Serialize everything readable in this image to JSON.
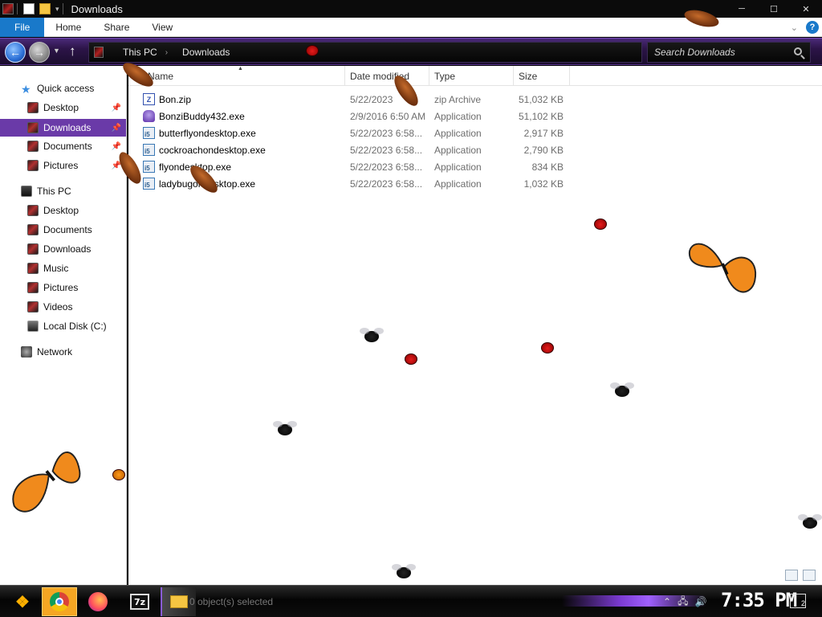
{
  "window": {
    "title": "Downloads",
    "controls": {
      "minimize": "─",
      "maximize": "☐",
      "close": "✕"
    }
  },
  "ribbon": {
    "tabs": [
      "File",
      "Home",
      "Share",
      "View"
    ],
    "help": "?"
  },
  "navigation": {
    "back": "←",
    "up": "↑",
    "breadcrumb": [
      "This PC",
      "Downloads"
    ],
    "search_placeholder": "Search Downloads"
  },
  "sidebar": {
    "quick_access": "Quick access",
    "quick_items": [
      {
        "label": "Desktop",
        "pinned": true
      },
      {
        "label": "Downloads",
        "pinned": true,
        "selected": true
      },
      {
        "label": "Documents",
        "pinned": true
      },
      {
        "label": "Pictures",
        "pinned": true
      }
    ],
    "this_pc": "This PC",
    "pc_items": [
      "Desktop",
      "Documents",
      "Downloads",
      "Music",
      "Pictures",
      "Videos",
      "Local Disk (C:)"
    ],
    "network": "Network"
  },
  "columns": {
    "name": "Name",
    "date": "Date modified",
    "type": "Type",
    "size": "Size"
  },
  "files": [
    {
      "name": "Bon.zip",
      "date": "5/22/2023",
      "type": "zip Archive",
      "size": "51,032 KB",
      "icon": "zip-icon"
    },
    {
      "name": "BonziBuddy432.exe",
      "date": "2/9/2016 6:50 AM",
      "type": "Application",
      "size": "51,102 KB",
      "icon": "bonzi-icon"
    },
    {
      "name": "butterflyondesktop.exe",
      "date": "5/22/2023 6:58...",
      "type": "Application",
      "size": "2,917 KB",
      "icon": "app-icon"
    },
    {
      "name": "cockroachondesktop.exe",
      "date": "5/22/2023 6:58...",
      "type": "Application",
      "size": "2,790 KB",
      "icon": "app-icon"
    },
    {
      "name": "flyondesktop.exe",
      "date": "5/22/2023 6:58...",
      "type": "Application",
      "size": "834 KB",
      "icon": "app-icon"
    },
    {
      "name": "ladybugondesktop.exe",
      "date": "5/22/2023 6:58...",
      "type": "Application",
      "size": "1,032 KB",
      "icon": "app-icon"
    }
  ],
  "status_bar": {
    "text": "0 object(s) selected"
  },
  "taskbar": {
    "apps": [
      "start",
      "chrome",
      "firefox",
      "7-zip",
      "file-explorer"
    ],
    "sevenzip_label": "7z",
    "clock": "7:35 PM",
    "notifications": "2"
  },
  "colors": {
    "accent": "#1979ca",
    "nav_purple": "#6a3aa8",
    "selected_row": "#6a3aa8"
  }
}
